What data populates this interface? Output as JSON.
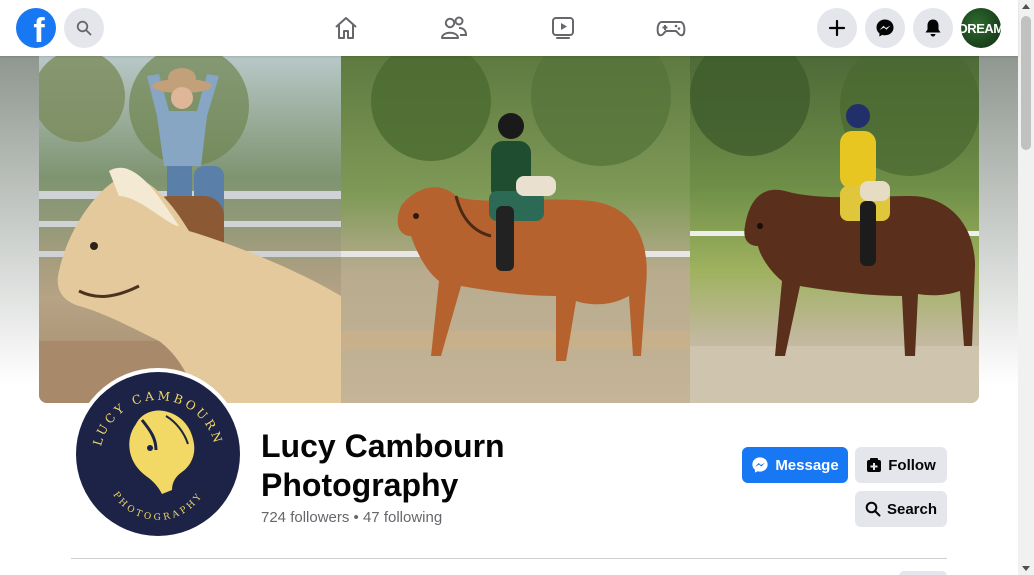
{
  "topbar": {
    "logo_letter": "f",
    "avatar_text": "DREAM",
    "icons": [
      "facebook-logo",
      "search-icon",
      "home-icon",
      "friends-icon",
      "watch-icon",
      "gaming-icon",
      "plus-icon",
      "messenger-icon",
      "bell-icon",
      "account-avatar"
    ]
  },
  "cover": {
    "panels": [
      "rider-cowgirl-palomino",
      "rider-green-chestnut-horse",
      "rider-yellow-bay-horse"
    ]
  },
  "profile": {
    "logo_name": "LUCY CAMBOURN",
    "logo_sub": "PHOTOGRAPHY",
    "title": "Lucy Cambourn Photography",
    "stats": "724 followers • 47 following"
  },
  "actions": {
    "message_label": "Message",
    "follow_label": "Follow",
    "search_label": "Search"
  },
  "colors": {
    "brand_blue": "#1877f2",
    "button_grey": "#e4e6eb",
    "text_dark": "#050505",
    "text_muted": "#65676b",
    "logo_navy": "#1c2346",
    "logo_gold": "#f2d864"
  }
}
